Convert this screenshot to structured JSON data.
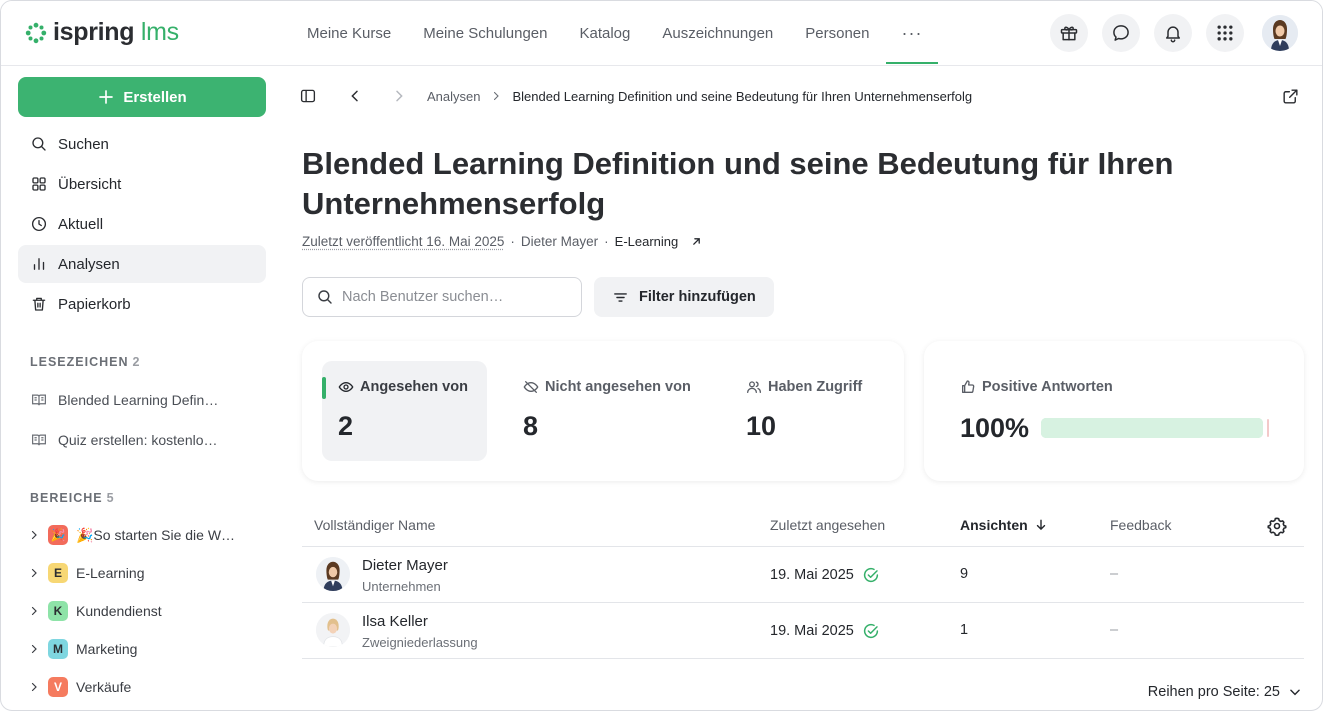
{
  "app": {
    "logo_primary": "ispring",
    "logo_secondary": "lms",
    "brand_color": "#35b06a"
  },
  "topnav": {
    "items": [
      {
        "label": "Meine Kurse"
      },
      {
        "label": "Meine Schulungen"
      },
      {
        "label": "Katalog"
      },
      {
        "label": "Auszeichnungen"
      },
      {
        "label": "Personen"
      }
    ],
    "more_label": "···",
    "icons": [
      "gift-icon",
      "chat-icon",
      "bell-icon",
      "apps-grid-icon"
    ]
  },
  "sidebar": {
    "create_label": "Erstellen",
    "menu": [
      {
        "label": "Suchen",
        "icon": "search-icon"
      },
      {
        "label": "Übersicht",
        "icon": "grid-icon"
      },
      {
        "label": "Aktuell",
        "icon": "clock-icon"
      },
      {
        "label": "Analysen",
        "icon": "bar-chart-icon"
      },
      {
        "label": "Papierkorb",
        "icon": "trash-icon"
      }
    ],
    "bookmarks_title": "LESEZEICHEN",
    "bookmarks_count": "2",
    "bookmarks": [
      {
        "label": "Blended Learning Defin…"
      },
      {
        "label": "Quiz erstellen: kostenlo…"
      }
    ],
    "areas_title": "BEREICHE",
    "areas_count": "5",
    "areas": [
      {
        "badge": "",
        "label": "🎉So starten Sie die W…",
        "color": "#f26b5b"
      },
      {
        "badge": "E",
        "label": "E-Learning",
        "color": "#f7d774"
      },
      {
        "badge": "K",
        "label": "Kundendienst",
        "color": "#8ee3a8"
      },
      {
        "badge": "M",
        "label": "Marketing",
        "color": "#7fd6e0"
      },
      {
        "badge": "V",
        "label": "Verkäufe",
        "color": "#f57b5f"
      }
    ]
  },
  "breadcrumb": {
    "parent": "Analysen",
    "current": "Blended Learning Definition und seine Bedeutung für Ihren Unternehmenserfolg"
  },
  "page": {
    "title": "Blended Learning Definition und seine Bedeutung für Ihren Unternehmenserfolg",
    "published": "Zuletzt veröffentlicht 16. Mai 2025",
    "author": "Dieter Mayer",
    "category": "E-Learning",
    "separator": "·"
  },
  "search": {
    "placeholder": "Nach Benutzer suchen…"
  },
  "filter": {
    "label": "Filter hinzufügen"
  },
  "stats": {
    "viewed_label": "Angesehen von",
    "viewed_value": "2",
    "not_viewed_label": "Nicht angesehen von",
    "not_viewed_value": "8",
    "access_label": "Haben Zugriff",
    "access_value": "10"
  },
  "positive": {
    "label": "Positive Antworten",
    "value": "100%",
    "fraction": 1.0
  },
  "table": {
    "columns": {
      "name": "Vollständiger Name",
      "last_viewed": "Zuletzt angesehen",
      "views": "Ansichten",
      "feedback": "Feedback"
    },
    "rows": [
      {
        "name": "Dieter Mayer",
        "dept": "Unternehmen",
        "last_viewed": "19. Mai 2025",
        "views": "9",
        "feedback": "–"
      },
      {
        "name": "Ilsa Keller",
        "dept": "Zweigniederlassung",
        "last_viewed": "19. Mai 2025",
        "views": "1",
        "feedback": "–"
      }
    ],
    "rows_per_page": "Reihen pro Seite: 25"
  }
}
